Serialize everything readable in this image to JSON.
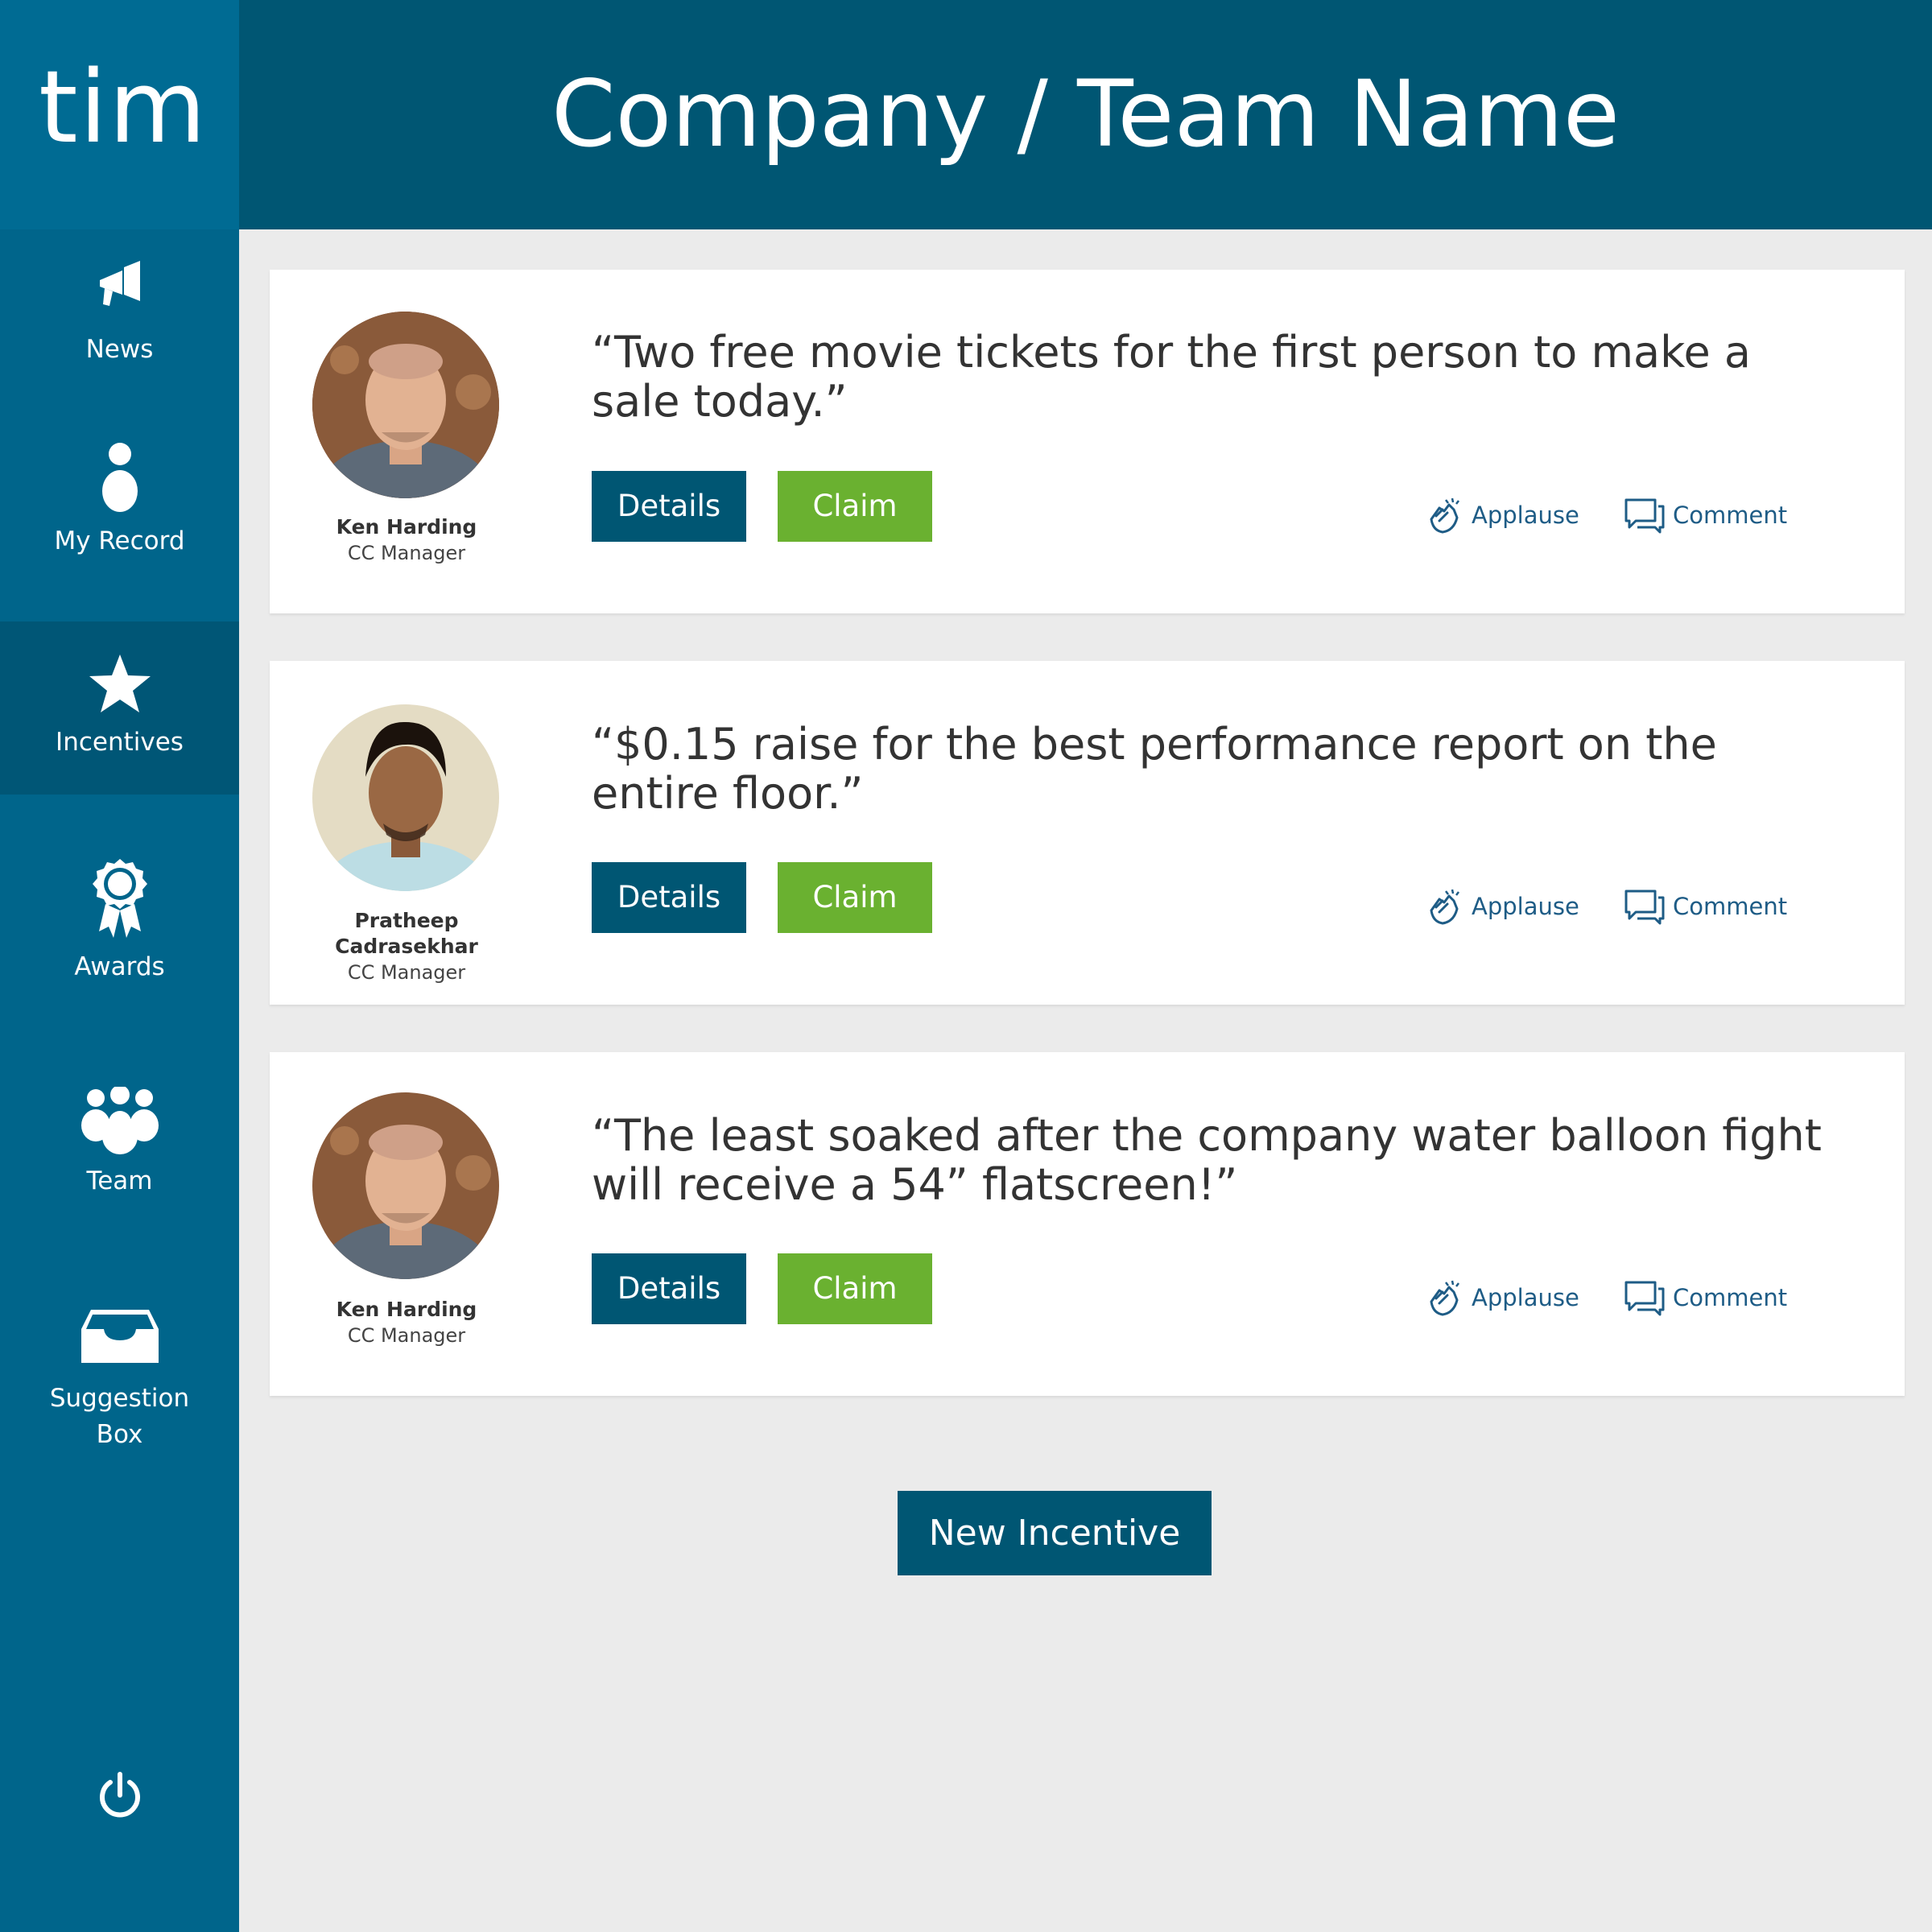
{
  "app": {
    "brand": "tim"
  },
  "header": {
    "title": "Company / Team Name"
  },
  "sidebar": {
    "items": [
      {
        "label": "News",
        "icon": "megaphone-icon"
      },
      {
        "label": "My Record",
        "icon": "person-icon"
      },
      {
        "label": "Incentives",
        "icon": "star-icon",
        "active": true
      },
      {
        "label": "Awards",
        "icon": "ribbon-icon"
      },
      {
        "label": "Team",
        "icon": "team-icon"
      },
      {
        "label_line1": "Suggestion",
        "label_line2": "Box",
        "icon": "inbox-icon"
      }
    ],
    "power_icon": "power-icon"
  },
  "incentives": [
    {
      "quote": "“Two free movie tickets for the first person to make a sale today.”",
      "name": "Ken Harding",
      "role": "CC Manager",
      "details_label": "Details",
      "claim_label": "Claim",
      "applause_label": "Applause",
      "comment_label": "Comment"
    },
    {
      "quote": "“$0.15 raise for the best performance report on the entire floor.”",
      "name_line1": "Pratheep",
      "name_line2": "Cadrasekhar",
      "role": "CC Manager",
      "details_label": "Details",
      "claim_label": "Claim",
      "applause_label": "Applause",
      "comment_label": "Comment"
    },
    {
      "quote": "“The least soaked after the company water balloon fight will receive a 54” flatscreen!”",
      "name": "Ken Harding",
      "role": "CC Manager",
      "details_label": "Details",
      "claim_label": "Claim",
      "applause_label": "Applause",
      "comment_label": "Comment"
    }
  ],
  "new_incentive_label": "New Incentive",
  "colors": {
    "sidebar": "#00658b",
    "header": "#005673",
    "primary_button": "#005673",
    "claim_button": "#6ab130",
    "action_text": "#1e5c86",
    "background": "#ebebeb"
  }
}
